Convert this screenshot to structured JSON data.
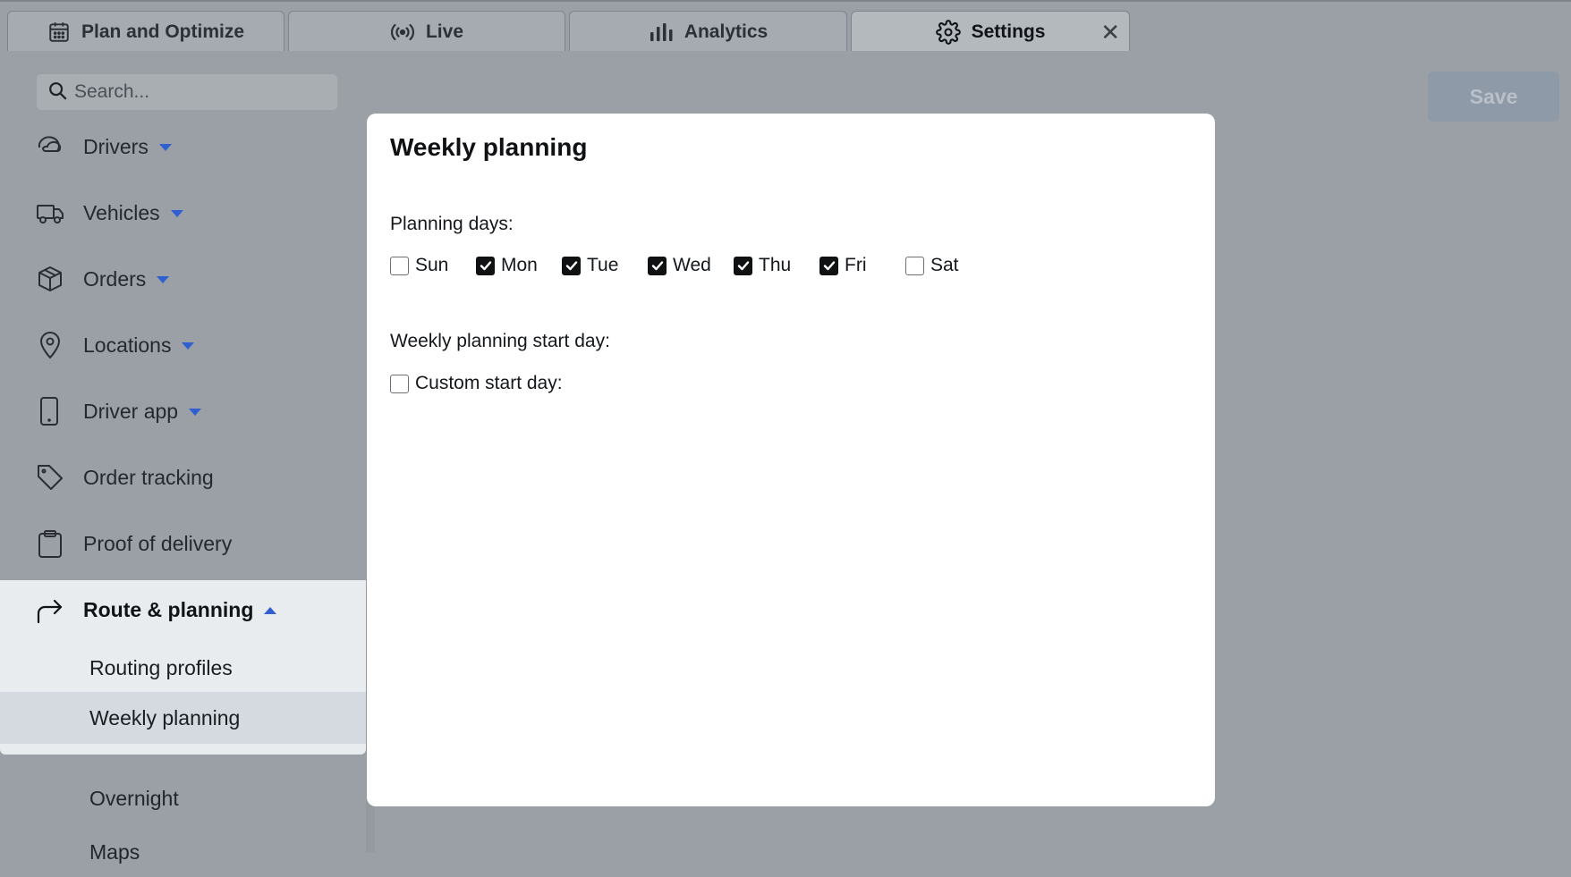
{
  "tabs": [
    {
      "label": "Plan and Optimize",
      "icon": "calendar-icon"
    },
    {
      "label": "Live",
      "icon": "broadcast-icon"
    },
    {
      "label": "Analytics",
      "icon": "bar-chart-icon"
    },
    {
      "label": "Settings",
      "icon": "gear-icon",
      "active": true,
      "close": "✕"
    }
  ],
  "search": {
    "placeholder": "Search..."
  },
  "sidebar": {
    "items": [
      {
        "label": "Drivers",
        "icon": "driver-icon",
        "caret": "down"
      },
      {
        "label": "Vehicles",
        "icon": "truck-icon",
        "caret": "down"
      },
      {
        "label": "Orders",
        "icon": "package-icon",
        "caret": "down"
      },
      {
        "label": "Locations",
        "icon": "map-pin-icon",
        "caret": "down"
      },
      {
        "label": "Driver app",
        "icon": "phone-icon",
        "caret": "down"
      },
      {
        "label": "Order tracking",
        "icon": "tag-icon"
      },
      {
        "label": "Proof of delivery",
        "icon": "clipboard-icon"
      }
    ],
    "open_group": {
      "label": "Route & planning",
      "icon": "route-arrow-icon",
      "children": [
        "Routing profiles",
        "Weekly planning"
      ]
    },
    "more_items": [
      "Overnight",
      "Maps"
    ]
  },
  "toolbar": {
    "save_label": "Save"
  },
  "modal": {
    "title": "Weekly planning",
    "planning_days_label": "Planning days:",
    "days": [
      {
        "label": "Sun",
        "checked": false
      },
      {
        "label": "Mon",
        "checked": true
      },
      {
        "label": "Tue",
        "checked": true
      },
      {
        "label": "Wed",
        "checked": true
      },
      {
        "label": "Thu",
        "checked": true
      },
      {
        "label": "Fri",
        "checked": true
      },
      {
        "label": "Sat",
        "checked": false
      }
    ],
    "start_day_label": "Weekly planning start day:",
    "custom_start_label": "Custom start day:",
    "custom_start_checked": false
  }
}
